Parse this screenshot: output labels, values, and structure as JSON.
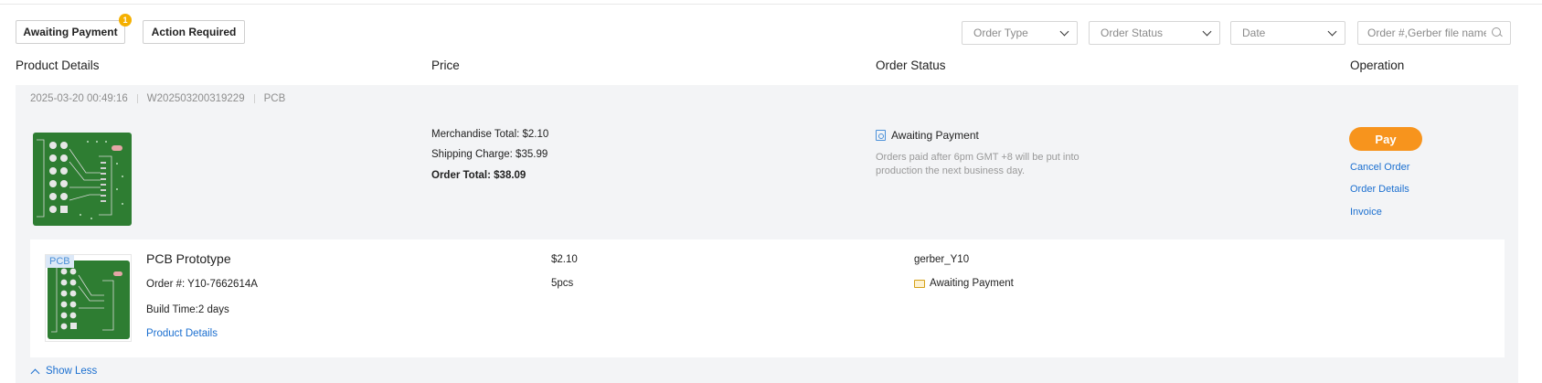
{
  "filters": {
    "tabs": [
      {
        "label": "Awaiting Payment",
        "badge": "1"
      },
      {
        "label": "Action Required"
      }
    ],
    "selects": {
      "order_type": "Order Type",
      "order_status": "Order Status",
      "date": "Date"
    },
    "search_placeholder": "Order #,Gerber file name..."
  },
  "columns": {
    "product": "Product Details",
    "price": "Price",
    "status": "Order Status",
    "operation": "Operation"
  },
  "order": {
    "datetime": "2025-03-20 00:49:16",
    "number": "W202503200319229",
    "category": "PCB",
    "merchandise_total": "Merchandise Total: $2.10",
    "shipping_charge": "Shipping Charge: $35.99",
    "order_total": "Order Total: $38.09",
    "status": "Awaiting Payment",
    "status_note": "Orders paid after 6pm GMT +8 will be put into production the next business day.",
    "actions": {
      "pay": "Pay",
      "cancel": "Cancel Order",
      "details": "Order Details",
      "invoice": "Invoice"
    },
    "item": {
      "tag": "PCB",
      "title": "PCB Prototype",
      "order_no": "Order #: Y10-7662614A",
      "build_time": "Build Time:2 days",
      "details_link": "Product Details",
      "price": "$2.10",
      "qty": "5pcs",
      "file": "gerber_Y10",
      "status": "Awaiting Payment"
    },
    "show_less": "Show Less"
  },
  "colors": {
    "accent_orange": "#f7941d",
    "link_blue": "#1b6fd0",
    "badge_yellow": "#f5b000",
    "pcb_green": "#2e7d32",
    "card_bg": "#f3f4f6"
  }
}
